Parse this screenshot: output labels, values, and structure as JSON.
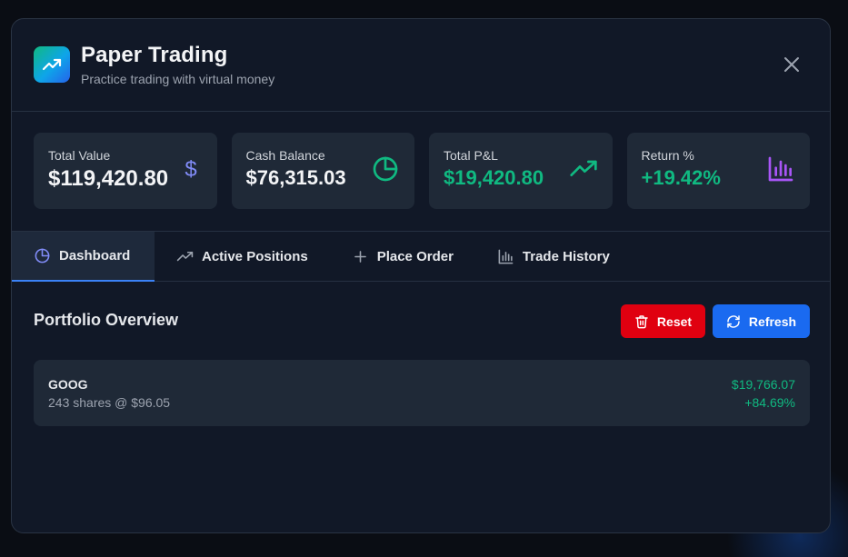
{
  "header": {
    "title": "Paper Trading",
    "subtitle": "Practice trading with virtual money",
    "app_icon": "trending-up-icon",
    "close_icon": "close-icon"
  },
  "stats": [
    {
      "label": "Total Value",
      "value": "$119,420.80",
      "icon": "dollar-icon",
      "icon_glyph": "$",
      "icon_color": "#818cf8"
    },
    {
      "label": "Cash Balance",
      "value": "$76,315.03",
      "icon": "pie-chart-icon",
      "icon_color": "#10b981"
    },
    {
      "label": "Total P&L",
      "value": "$19,420.80",
      "icon": "trending-up-icon",
      "icon_color": "#10b981"
    },
    {
      "label": "Return %",
      "value": "+19.42%",
      "icon": "bar-chart-icon",
      "icon_color": "#a855f7"
    }
  ],
  "tabs": [
    {
      "label": "Dashboard",
      "icon": "pie-chart-icon",
      "active": true
    },
    {
      "label": "Active Positions",
      "icon": "trending-up-icon",
      "active": false
    },
    {
      "label": "Place Order",
      "icon": "plus-icon",
      "active": false
    },
    {
      "label": "Trade History",
      "icon": "bar-chart-icon",
      "active": false
    }
  ],
  "main": {
    "section_title": "Portfolio Overview",
    "reset_label": "Reset",
    "refresh_label": "Refresh",
    "positions": [
      {
        "symbol": "GOOG",
        "detail": "243 shares @ $96.05",
        "value": "$19,766.07",
        "change": "+84.69%"
      }
    ]
  },
  "colors": {
    "accent": "#3b82f6",
    "positive": "#10b981",
    "danger": "#e00010",
    "primary_button": "#1a6af0",
    "card_bg": "#1f2937",
    "modal_bg": "#111827"
  }
}
